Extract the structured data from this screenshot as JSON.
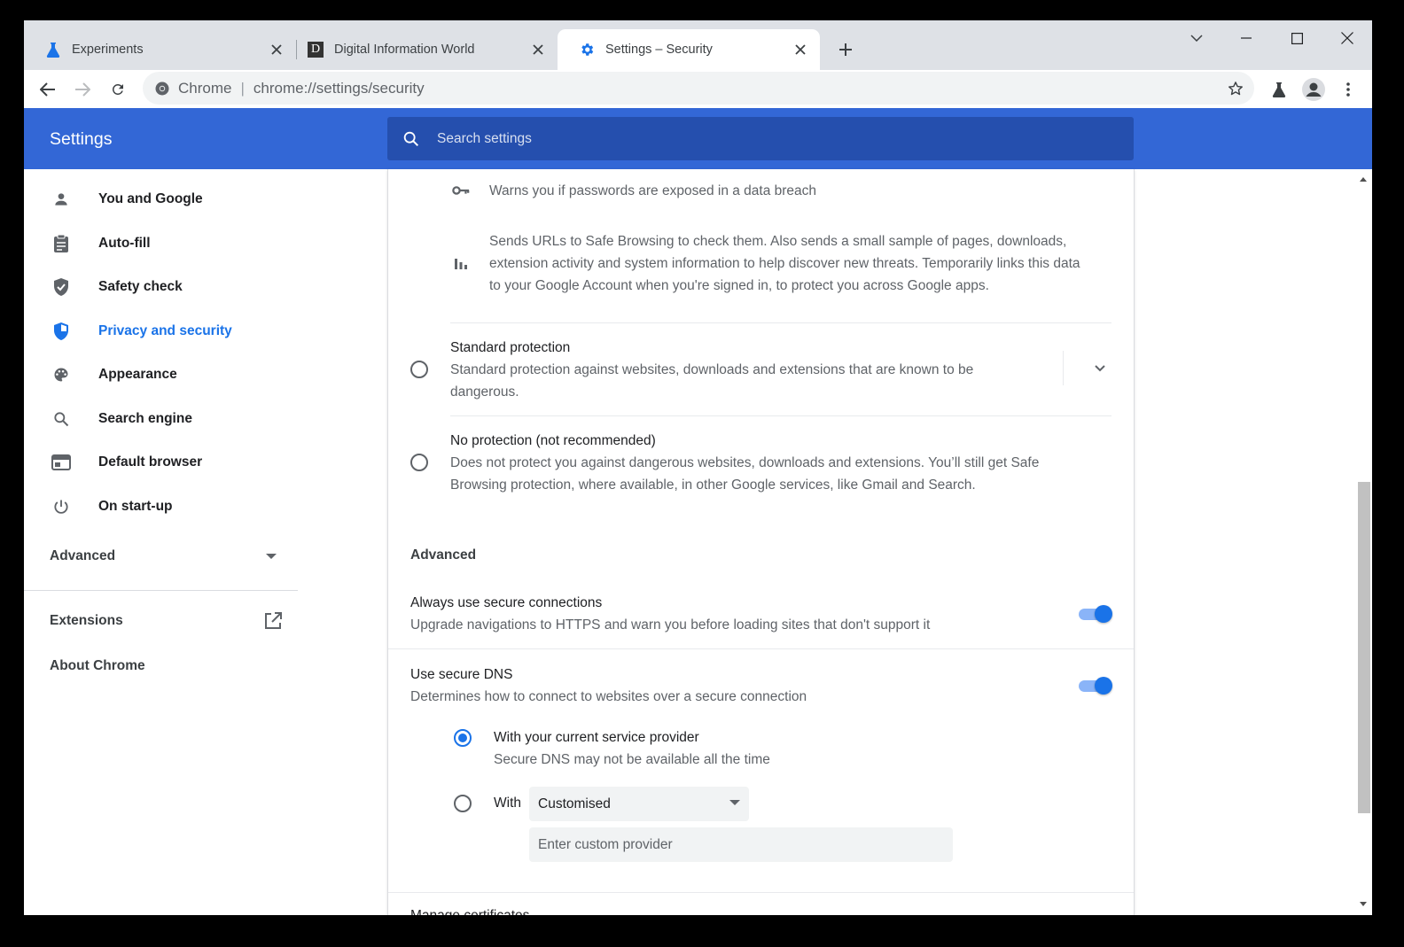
{
  "tabs": [
    {
      "title": "Experiments",
      "icon": "flask-icon"
    },
    {
      "title": "Digital Information World",
      "icon": "d-logo-icon",
      "favicon_letter": "D"
    },
    {
      "title": "Settings – Security",
      "icon": "gear-icon",
      "active": true
    }
  ],
  "omnibox": {
    "site": "Chrome",
    "separator": "|",
    "url": "chrome://settings/security"
  },
  "header": {
    "title": "Settings",
    "search_placeholder": "Search settings"
  },
  "sidebar": {
    "items": [
      {
        "label": "You and Google",
        "icon": "person-icon"
      },
      {
        "label": "Auto-fill",
        "icon": "clipboard-icon"
      },
      {
        "label": "Safety check",
        "icon": "shield-check-icon"
      },
      {
        "label": "Privacy and security",
        "icon": "shield-half-icon",
        "selected": true
      },
      {
        "label": "Appearance",
        "icon": "palette-icon"
      },
      {
        "label": "Search engine",
        "icon": "search-icon"
      },
      {
        "label": "Default browser",
        "icon": "browser-window-icon"
      },
      {
        "label": "On start-up",
        "icon": "power-icon"
      }
    ],
    "advanced": "Advanced",
    "extensions": "Extensions",
    "about": "About Chrome"
  },
  "content": {
    "enhanced_details": {
      "password_warning": "Warns you if passwords are exposed in a data breach",
      "url_check_line1": "Sends URLs to Safe Browsing to check them. Also sends a small sample of pages, downloads,",
      "url_check_line2": "extension activity and system information to help discover new threats. Temporarily links this data",
      "url_check_line3": "to your Google Account when you're signed in, to protect you across Google apps."
    },
    "standard": {
      "title": "Standard protection",
      "desc_line1": "Standard protection against websites, downloads and extensions that are known to be",
      "desc_line2": "dangerous."
    },
    "none": {
      "title": "No protection (not recommended)",
      "desc_line1": "Does not protect you against dangerous websites, downloads and extensions. You’ll still get Safe",
      "desc_line2": "Browsing protection, where available, in other Google services, like Gmail and Search."
    },
    "advanced_heading": "Advanced",
    "https": {
      "title": "Always use secure connections",
      "desc": "Upgrade navigations to HTTPS and warn you before loading sites that don't support it",
      "enabled": true
    },
    "dns": {
      "title": "Use secure DNS",
      "desc": "Determines how to connect to websites over a secure connection",
      "enabled": true,
      "option_current_title": "With your current service provider",
      "option_current_desc": "Secure DNS may not be available all the time",
      "option_with_label": "With",
      "provider_selected": "Customised",
      "custom_placeholder": "Enter custom provider"
    },
    "next_section": "Manage certificates"
  },
  "colors": {
    "accent": "#1a73e8",
    "header_blue": "#3367d6",
    "search_blue": "#254fae"
  }
}
